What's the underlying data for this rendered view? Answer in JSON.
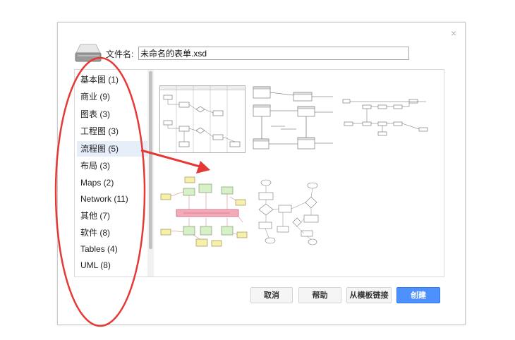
{
  "dialog": {
    "filename_label": "文件名:",
    "filename_value": "未命名的表单.xsd",
    "close_glyph": "×"
  },
  "categories": [
    {
      "label": "基本图 (1)",
      "selected": false
    },
    {
      "label": "商业 (9)",
      "selected": false
    },
    {
      "label": "图表 (3)",
      "selected": false
    },
    {
      "label": "工程图 (3)",
      "selected": false
    },
    {
      "label": "流程图 (5)",
      "selected": true
    },
    {
      "label": "布局 (3)",
      "selected": false
    },
    {
      "label": "Maps (2)",
      "selected": false
    },
    {
      "label": "Network (11)",
      "selected": false
    },
    {
      "label": "其他 (7)",
      "selected": false
    },
    {
      "label": "软件 (8)",
      "selected": false
    },
    {
      "label": "Tables (4)",
      "selected": false
    },
    {
      "label": "UML (8)",
      "selected": false
    }
  ],
  "templates": [
    {
      "name": "swimlane-flowchart-template"
    },
    {
      "name": "process-flow-template"
    },
    {
      "name": "horizontal-flow-template"
    },
    {
      "name": "colored-flowchart-template"
    },
    {
      "name": "decision-flowchart-template"
    }
  ],
  "buttons": {
    "cancel": "取消",
    "help": "帮助",
    "from_link": "从模板链接",
    "create": "创建"
  },
  "annotation": {
    "color": "#e53935"
  },
  "colors": {
    "accent": "#4d90fe",
    "selected_bg": "#e6eef9"
  }
}
